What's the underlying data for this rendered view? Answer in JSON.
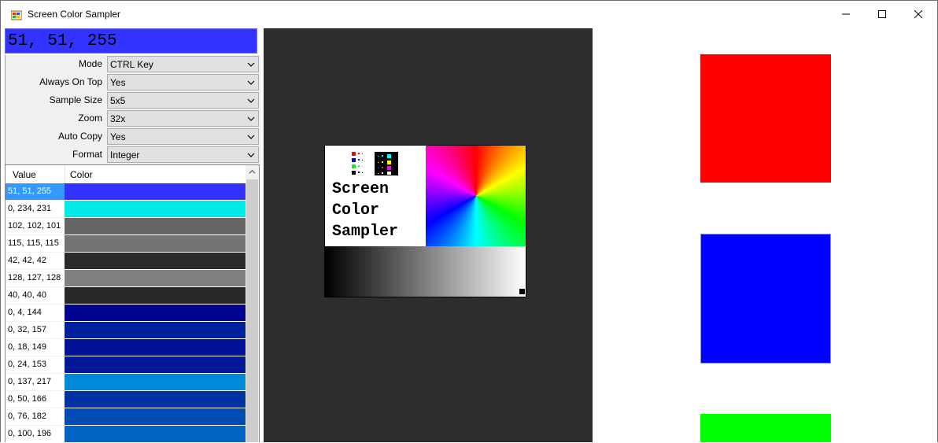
{
  "window": {
    "title": "Screen Color Sampler"
  },
  "readout": {
    "value": "51, 51, 255",
    "color": "#3333ff"
  },
  "settings": [
    {
      "label": "Mode",
      "value": "CTRL Key"
    },
    {
      "label": "Always On Top",
      "value": "Yes"
    },
    {
      "label": "Sample Size",
      "value": "5x5"
    },
    {
      "label": "Zoom",
      "value": "32x"
    },
    {
      "label": "Auto Copy",
      "value": "Yes"
    },
    {
      "label": "Format",
      "value": "Integer"
    }
  ],
  "history": {
    "columns": [
      "Value",
      "Color"
    ],
    "rows": [
      {
        "value": "51, 51, 255",
        "color": "#3333ff",
        "selected": true
      },
      {
        "value": "0, 234, 231",
        "color": "#00eae7"
      },
      {
        "value": "102, 102, 101",
        "color": "#666665"
      },
      {
        "value": "115, 115, 115",
        "color": "#737373"
      },
      {
        "value": "42, 42, 42",
        "color": "#2a2a2a"
      },
      {
        "value": "128, 127, 128",
        "color": "#807f80"
      },
      {
        "value": "40, 40, 40",
        "color": "#282828"
      },
      {
        "value": "0, 4, 144",
        "color": "#000490"
      },
      {
        "value": "0, 32, 157",
        "color": "#00209d"
      },
      {
        "value": "0, 18, 149",
        "color": "#001295"
      },
      {
        "value": "0, 24, 153",
        "color": "#001899"
      },
      {
        "value": "0, 137, 217",
        "color": "#0089d9"
      },
      {
        "value": "0, 50, 166",
        "color": "#0032a6"
      },
      {
        "value": "0, 76, 182",
        "color": "#004cb6"
      },
      {
        "value": "0, 100, 196",
        "color": "#0064c4"
      }
    ]
  },
  "preview": {
    "text": "Screen\nColor\nSampler"
  },
  "canvas": {
    "squares": [
      "#ff0000",
      "#0000ff",
      "#00ff00"
    ]
  }
}
